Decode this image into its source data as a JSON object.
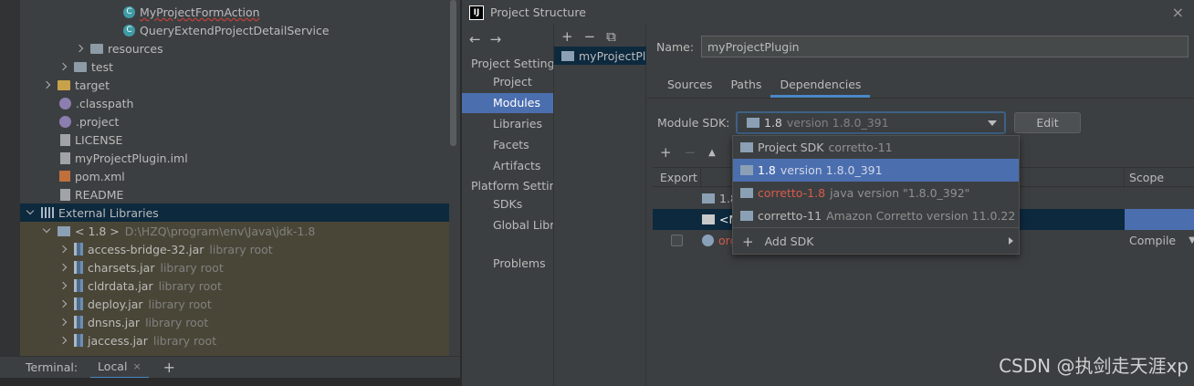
{
  "project_tree": {
    "rows": [
      {
        "label": "MyProjectFormAction",
        "hint": "",
        "icon": "class-icon"
      },
      {
        "label": "QueryExtendProjectDetailService",
        "hint": "",
        "icon": "class-icon"
      },
      {
        "label": "resources",
        "hint": "",
        "icon": "folder-icon"
      },
      {
        "label": "test",
        "hint": "",
        "icon": "folder-icon"
      },
      {
        "label": "target",
        "hint": "",
        "icon": "folder-icon"
      },
      {
        "label": ".classpath",
        "hint": "",
        "icon": "config-file-icon"
      },
      {
        "label": ".project",
        "hint": "",
        "icon": "config-file-icon"
      },
      {
        "label": "LICENSE",
        "hint": "",
        "icon": "text-file-icon"
      },
      {
        "label": "myProjectPlugin.iml",
        "hint": "",
        "icon": "iml-file-icon"
      },
      {
        "label": "pom.xml",
        "hint": "",
        "icon": "maven-file-icon"
      },
      {
        "label": "README",
        "hint": "",
        "icon": "text-file-icon"
      },
      {
        "label": "External Libraries",
        "hint": "",
        "icon": "libraries-icon"
      },
      {
        "label": "< 1.8 >",
        "hint": "D:\\HZQ\\program\\env\\Java\\jdk-1.8",
        "icon": "sdk-folder-icon"
      },
      {
        "label": "access-bridge-32.jar",
        "hint": "library root",
        "icon": "jar-icon"
      },
      {
        "label": "charsets.jar",
        "hint": "library root",
        "icon": "jar-icon"
      },
      {
        "label": "cldrdata.jar",
        "hint": "library root",
        "icon": "jar-icon"
      },
      {
        "label": "deploy.jar",
        "hint": "library root",
        "icon": "jar-icon"
      },
      {
        "label": "dnsns.jar",
        "hint": "library root",
        "icon": "jar-icon"
      },
      {
        "label": "jaccess.jar",
        "hint": "library root",
        "icon": "jar-icon"
      }
    ]
  },
  "terminal": {
    "label": "Terminal:",
    "tab": "Local",
    "tab_close": "×",
    "add": "+"
  },
  "dialog": {
    "title": "Project Structure",
    "close": "×",
    "nav_back": "←",
    "nav_forward": "→",
    "sections": [
      {
        "heading": "Project Settings",
        "items": [
          "Project",
          "Modules",
          "Libraries",
          "Facets",
          "Artifacts"
        ]
      },
      {
        "heading": "Platform Settings",
        "items": [
          "SDKs",
          "Global Libraries"
        ]
      }
    ],
    "problems": "Problems",
    "selected_nav": "Modules",
    "modules_toolbar": {
      "add": "+",
      "remove": "−",
      "copy": "⧉"
    },
    "module_item": "myProjectPlugin",
    "name_label": "Name:",
    "name_value": "myProjectPlugin",
    "tabs": [
      "Sources",
      "Paths",
      "Dependencies"
    ],
    "active_tab": "Dependencies",
    "module_sdk_label": "Module SDK:",
    "module_sdk_value": "1.8",
    "module_sdk_version": "version 1.8.0_391",
    "edit_button": "Edit",
    "dep_toolbar": {
      "add": "+",
      "remove": "−",
      "up": "▲",
      "down": "▼"
    },
    "dep_columns": [
      "Export",
      "Scope"
    ],
    "dep_rows": [
      {
        "label": "1.8",
        "scope": "",
        "error": false
      },
      {
        "label": "<M",
        "scope": "",
        "error": false
      },
      {
        "label": "org",
        "scope": "Compile",
        "error": true
      }
    ]
  },
  "sdk_popup": {
    "items": [
      {
        "name": "Project SDK",
        "detail": "corretto-11",
        "error": false
      },
      {
        "name": "1.8",
        "detail": "version 1.8.0_391",
        "error": false
      },
      {
        "name": "corretto-1.8",
        "detail": "java version \"1.8.0_392\"",
        "error": true
      },
      {
        "name": "corretto-11",
        "detail": "Amazon Corretto version 11.0.22",
        "error": false
      }
    ],
    "selected_index": 1,
    "add_sdk": "Add SDK"
  },
  "watermark": "CSDN @执剑走天涯xp",
  "colors": {
    "selection": "#4b6eaf",
    "error_red": "#d75b4b",
    "focus_border": "#3d6185",
    "library_row_bg": "#4a4637"
  }
}
